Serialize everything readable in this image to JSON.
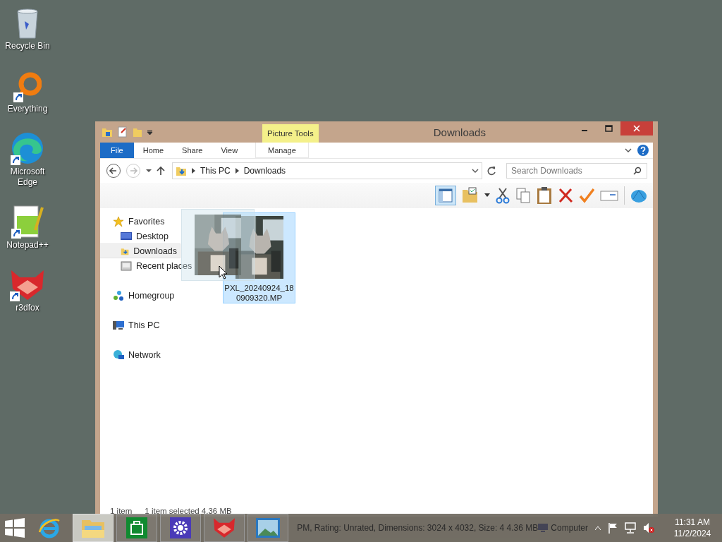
{
  "desktop_icons": [
    {
      "label": "Recycle Bin",
      "kind": "recycle",
      "shortcut": false
    },
    {
      "label": "Everything",
      "kind": "everything",
      "shortcut": true
    },
    {
      "label": "Microsoft Edge",
      "kind": "edge",
      "shortcut": true
    },
    {
      "label": "Notepad++",
      "kind": "notepad",
      "shortcut": true
    },
    {
      "label": "r3dfox",
      "kind": "fox",
      "shortcut": true
    }
  ],
  "window": {
    "title": "Downloads",
    "context_tab": "Picture Tools",
    "ribbon_tabs": [
      {
        "label": "File",
        "kind": "file",
        "selected": false
      },
      {
        "label": "Home",
        "kind": "plain",
        "selected": false
      },
      {
        "label": "Share",
        "kind": "plain",
        "selected": false
      },
      {
        "label": "View",
        "kind": "plain",
        "selected": false
      },
      {
        "label": "Manage",
        "kind": "context",
        "selected": false
      }
    ],
    "address": {
      "path": [
        "This PC",
        "Downloads"
      ]
    },
    "search": {
      "placeholder": "Search Downloads"
    },
    "nav": [
      {
        "label": "Favorites",
        "selected": false,
        "children": [
          {
            "label": "Desktop",
            "selected": false
          },
          {
            "label": "Downloads",
            "selected": true
          },
          {
            "label": "Recent places",
            "selected": false
          }
        ]
      },
      {
        "label": "Homegroup",
        "selected": false
      },
      {
        "label": "This PC",
        "selected": false
      },
      {
        "label": "Network",
        "selected": false
      }
    ],
    "files": [
      {
        "name": "PXL_20240924_180909320.MP",
        "kind": "picture",
        "selected": true
      }
    ],
    "status_bar": {
      "count": "1 item",
      "selection": "1 item selected 4.36 MB"
    }
  },
  "taskbar": {
    "apps": [
      {
        "kind": "ie",
        "running": false,
        "active": false
      },
      {
        "kind": "explorer",
        "running": true,
        "active": true
      },
      {
        "kind": "store",
        "running": true,
        "active": false
      },
      {
        "kind": "settings",
        "running": true,
        "active": false
      },
      {
        "kind": "fox",
        "running": true,
        "active": false
      },
      {
        "kind": "photos",
        "running": true,
        "active": false
      }
    ],
    "details": "PM, Rating: Unrated, Dimensions: 3024 x 4032, Size: 4  4.36 MB",
    "tray_label": "Computer",
    "clock": {
      "time": "11:31 AM",
      "date": "11/2/2024"
    }
  }
}
